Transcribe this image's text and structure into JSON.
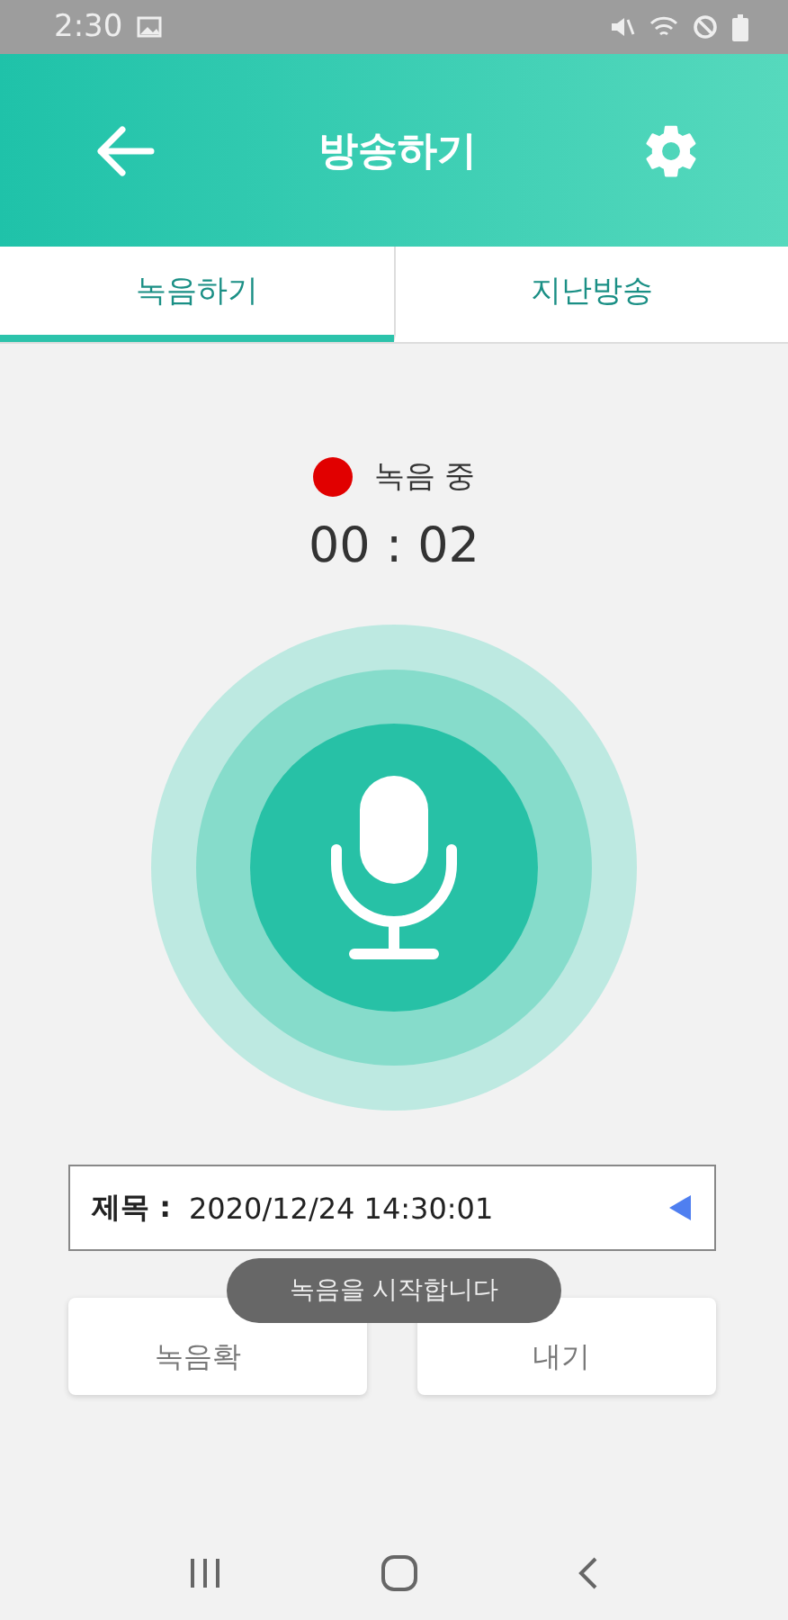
{
  "status_bar": {
    "time": "2:30"
  },
  "header": {
    "title": "방송하기"
  },
  "tabs": [
    {
      "label": "녹음하기",
      "selected": true
    },
    {
      "label": "지난방송",
      "selected": false
    }
  ],
  "recorder": {
    "recording": true,
    "status": "녹음 중",
    "timer": "00 : 02"
  },
  "title_field": {
    "label": "제목 :",
    "value": "2020/12/24 14:30:01"
  },
  "buttons": [
    "녹음확",
    "내기"
  ],
  "toast": "녹음을 시작합니다"
}
